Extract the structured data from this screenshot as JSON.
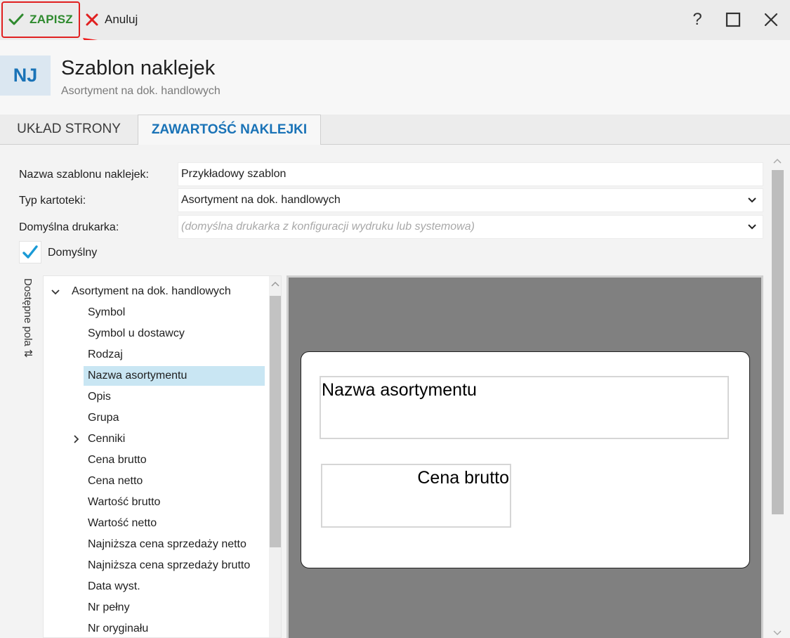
{
  "toolbar": {
    "save_label": "ZAPISZ",
    "cancel_label": "Anuluj",
    "help_label": "?"
  },
  "header": {
    "avatar": "NJ",
    "title": "Szablon naklejek",
    "subtitle": "Asortyment na dok. handlowych"
  },
  "tabs": [
    {
      "label": "UKŁAD STRONY"
    },
    {
      "label": "ZAWARTOŚĆ NAKLEJKI"
    }
  ],
  "form": {
    "name_label": "Nazwa szablonu naklejek:",
    "name_value": "Przykładowy szablon",
    "type_label": "Typ kartoteki:",
    "type_value": "Asortyment na dok. handlowych",
    "printer_label": "Domyślna drukarka:",
    "printer_placeholder": "(domyślna drukarka z konfiguracji wydruku lub systemowa)",
    "default_label": "Domyślny"
  },
  "tree": {
    "side_label": "Dostępne pola ⇅",
    "root": "Asortyment na dok. handlowych",
    "items": [
      "Symbol",
      "Symbol u dostawcy",
      "Rodzaj",
      "Nazwa asortymentu",
      "Opis",
      "Grupa",
      "Cenniki",
      "Cena brutto",
      "Cena netto",
      "Wartość brutto",
      "Wartość netto",
      "Najniższa cena sprzedaży netto",
      "Najniższa cena sprzedaży brutto",
      "Data wyst.",
      "Nr pełny",
      "Nr oryginału"
    ]
  },
  "label_preview": {
    "field1": "Nazwa asortymentu",
    "field2": "Cena brutto"
  },
  "colors": {
    "save_accent": "#2e8a2e",
    "highlight_border": "#e02020",
    "active_tab": "#1a73b7",
    "selected_row": "#c9e6f3",
    "check_color": "#1a9ad6"
  }
}
